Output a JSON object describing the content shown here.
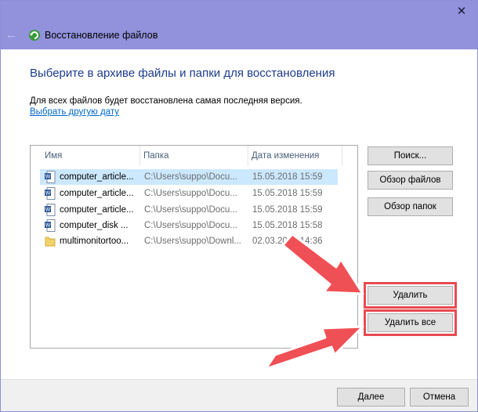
{
  "window": {
    "title": "Восстановление файлов"
  },
  "heading": "Выберите в архиве файлы и папки для восстановления",
  "subtext": "Для всех файлов будет восстановлена самая последняя версия.",
  "link": "Выбрать другую дату",
  "list": {
    "columns": {
      "name": "Имя",
      "folder": "Папка",
      "date": "Дата изменения"
    },
    "rows": [
      {
        "name": "computer_article...",
        "folder": "C:\\Users\\suppo\\Docu...",
        "date": "15.05.2018 15:59",
        "icon": "word-document-icon",
        "selected": true
      },
      {
        "name": "computer_article...",
        "folder": "C:\\Users\\suppo\\Docu...",
        "date": "15.05.2018 15:59",
        "icon": "word-document-icon",
        "selected": false
      },
      {
        "name": "computer_article...",
        "folder": "C:\\Users\\suppo\\Docu...",
        "date": "15.05.2018 15:59",
        "icon": "word-document-icon",
        "selected": false
      },
      {
        "name": "computer_disk ...",
        "folder": "C:\\Users\\suppo\\Docu...",
        "date": "15.05.2018 15:58",
        "icon": "word-document-icon",
        "selected": false
      },
      {
        "name": "multimonitortoo...",
        "folder": "C:\\Users\\suppo\\Downl...",
        "date": "02.03.2018 14:36",
        "icon": "folder-icon",
        "selected": false
      }
    ]
  },
  "buttons": {
    "search": "Поиск...",
    "browse_files": "Обзор файлов",
    "browse_folders": "Обзор папок",
    "delete": "Удалить",
    "delete_all": "Удалить все",
    "next": "Далее",
    "cancel": "Отмена"
  },
  "colors": {
    "titlebar": "#9191dc",
    "heading": "#1c3c8c",
    "link": "#0066cc",
    "selected_row": "#cce8ff",
    "highlight_arrow": "#e84a50"
  }
}
